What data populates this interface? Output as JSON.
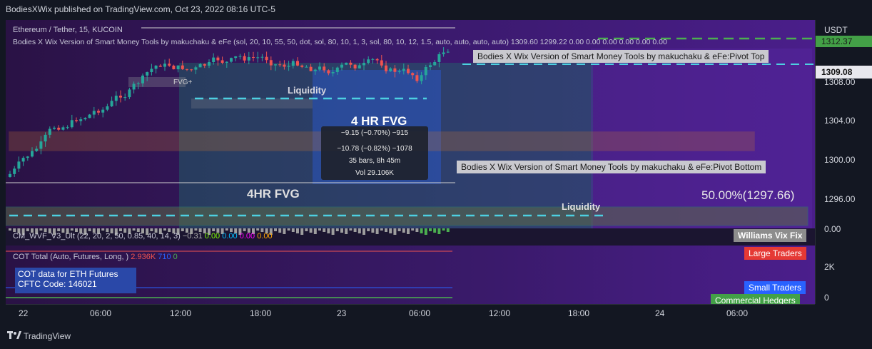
{
  "header": {
    "publish_line": "BodiesXWix published on TradingView.com, Oct 23, 2022 08:16 UTC-5"
  },
  "chart": {
    "symbol_line": "Ethereum / Tether, 15, KUCOIN",
    "indicator_line": "Bodies X Wix Version of Smart Money Tools by makuchaku & eFe (sol, 20, 10, 55, 50, dot, sol, 80, 10, 1, 3, sol, 80, 10, 12, 1.5, auto, auto, auto, auto) 1309.60 1299.22 0.00 0.00 0.00 0.00 0.00 0.00",
    "labels": {
      "fvg_4hr_top": "4 HR FVG",
      "fvg_4hr_bottom": "4HR FVG",
      "liquidity_top": "Liquidity",
      "liquidity_bottom": "Liquidity",
      "fvg_small": "FVG+",
      "pivot_top": "Bodies X Wix Version of Smart Money Tools by makuchaku & eFe:Pivot Top",
      "pivot_bottom": "Bodies X Wix Version of Smart Money Tools by makuchaku & eFe:Pivot Bottom",
      "fib_level": "50.00%(1297.66)"
    },
    "tooltip": {
      "line1": "−9.15 (−0.70%) −915",
      "line2": "−10.78 (−0.82%) −1078",
      "line3": "35 bars, 8h 45m",
      "line4": "Vol 29.106K"
    },
    "colors": {
      "up": "#26a69a",
      "down": "#ef5350",
      "liquidity": "#4dd0e1",
      "ob_zone": "#c87533"
    }
  },
  "price_axis": {
    "currency": "USDT",
    "ticks": [
      "1308.00",
      "1304.00",
      "1300.00",
      "1296.00"
    ],
    "current_price": "1309.08",
    "top_value": "1312.37",
    "wvf_zero": "0.00",
    "cot_ticks": [
      "2K",
      "0"
    ]
  },
  "wvf_pane": {
    "legend": "CM_WVF_V3_Ult (22, 20, 2, 50, 0.85, 40, 14, 3)",
    "values": [
      "−0.31",
      "0.00",
      "0.00",
      "0.00",
      "0.00"
    ],
    "tag": "Williams Vix Fix"
  },
  "cot_pane": {
    "legend": "COT Total (Auto, Futures, Long, )",
    "val1": "2.936K",
    "val2": "710",
    "val3": "0",
    "info_line1": "COT data for ETH Futures",
    "info_line2": "CFTC Code: 146021",
    "tag_large": "Large Traders",
    "tag_small": "Small Traders",
    "tag_commercial": "Commercial Hedgers"
  },
  "time_axis": {
    "labels": [
      "22",
      "06:00",
      "12:00",
      "18:00",
      "23",
      "06:00",
      "12:00",
      "18:00",
      "24",
      "06:00"
    ]
  },
  "footer": {
    "brand": "TradingView"
  }
}
